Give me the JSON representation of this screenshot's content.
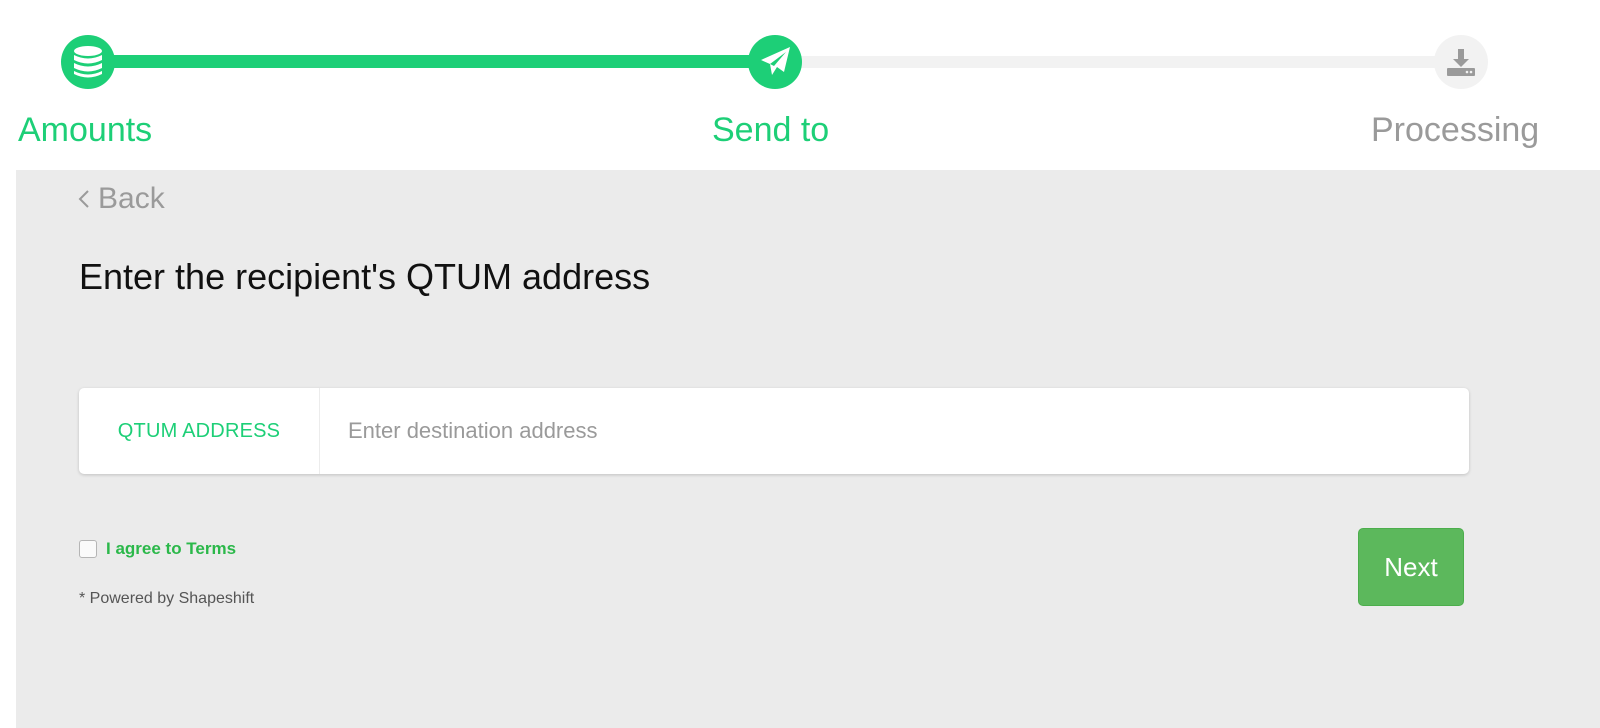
{
  "stepper": {
    "colors": {
      "complete": "#1dcf77",
      "pending": "#f2f2f2",
      "pending_text": "#9a9a9a"
    },
    "steps": [
      {
        "label": "Amounts",
        "icon": "database-coins-icon",
        "state": "complete"
      },
      {
        "label": "Send to",
        "icon": "paper-plane-icon",
        "state": "active"
      },
      {
        "label": "Processing",
        "icon": "download-tray-icon",
        "state": "pending"
      }
    ]
  },
  "back_label": "Back",
  "title": "Enter the recipient's QTUM address",
  "address": {
    "label": "QTUM ADDRESS",
    "placeholder": "Enter destination address",
    "value": ""
  },
  "terms": {
    "label": "I agree to Terms",
    "checked": false
  },
  "powered_by": "* Powered by Shapeshift",
  "next_label": "Next",
  "colors": {
    "accent": "#1dcf77",
    "button": "#5cb85c",
    "terms": "#2bb84a",
    "panel_bg": "#ebebeb"
  }
}
